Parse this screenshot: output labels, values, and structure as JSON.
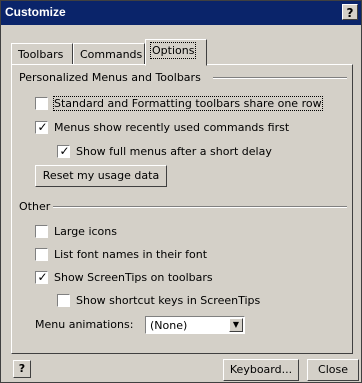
{
  "window": {
    "title": "Customize",
    "help_symbol": "?"
  },
  "tabs": [
    {
      "label": "Toolbars",
      "active": false
    },
    {
      "label": "Commands",
      "active": false
    },
    {
      "label": "Options",
      "active": true
    }
  ],
  "personalized": {
    "title": "Personalized Menus and Toolbars",
    "share_row": {
      "label": "Standard and Formatting toolbars share one row",
      "checked": false
    },
    "recent_first": {
      "label": "Menus show recently used commands first",
      "checked": true
    },
    "full_menus": {
      "label": "Show full menus after a short delay",
      "checked": true
    },
    "reset_button": "Reset my usage data"
  },
  "other": {
    "title": "Other",
    "large_icons": {
      "label": "Large icons",
      "checked": false
    },
    "font_names": {
      "label": "List font names in their font",
      "checked": false
    },
    "screentips": {
      "label": "Show ScreenTips on toolbars",
      "checked": true
    },
    "shortcut_keys": {
      "label": "Show shortcut keys in ScreenTips",
      "checked": false
    },
    "menu_animations_label": "Menu animations:",
    "menu_animations_value": "(None)"
  },
  "footer": {
    "help_symbol": "?",
    "keyboard_button": "Keyboard...",
    "close_button": "Close"
  }
}
